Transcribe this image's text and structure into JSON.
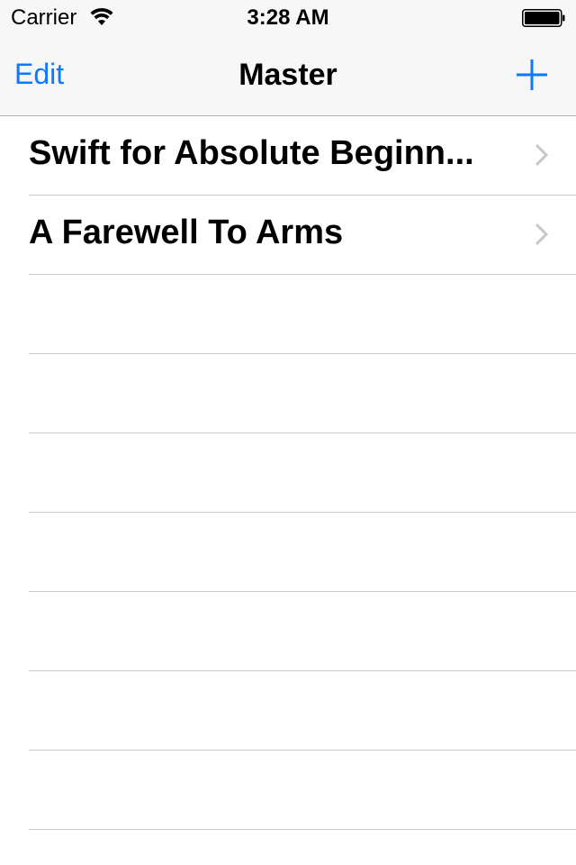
{
  "status_bar": {
    "carrier": "Carrier",
    "time": "3:28 AM"
  },
  "nav": {
    "edit_label": "Edit",
    "title": "Master",
    "add_icon": "plus-icon"
  },
  "rows": [
    {
      "title": "Swift for Absolute Beginn...",
      "icon": "chevron-right-icon"
    },
    {
      "title": "A Farewell To Arms",
      "icon": "chevron-right-icon"
    }
  ],
  "colors": {
    "accent": "#0a7aff",
    "bar_background": "#f7f7f7",
    "separator": "#c8c7cc",
    "chevron": "#c7c7cc"
  }
}
